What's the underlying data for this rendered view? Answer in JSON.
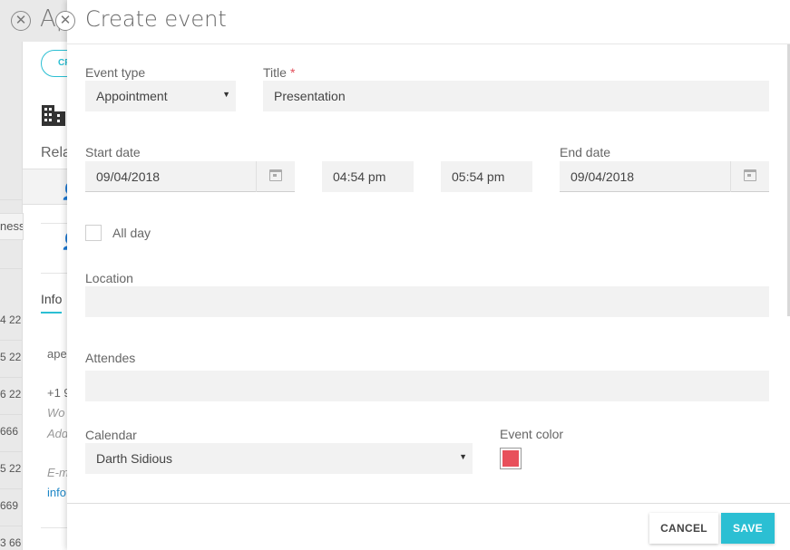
{
  "background": {
    "title": "Ap",
    "pill_label": "CR",
    "related_label": "Rela",
    "info_tab": "Info",
    "info_lines": [
      "ape",
      "+1 9",
      "Wo",
      "Add",
      "E-m",
      "info"
    ],
    "left_edge_box": "ness",
    "left_edge_rows": [
      "4 22",
      "5 22",
      "6 22",
      "666",
      "5 22",
      "669",
      "3 66"
    ]
  },
  "modal": {
    "title": "Create event",
    "event_type": {
      "label": "Event type",
      "value": "Appointment"
    },
    "title_field": {
      "label": "Title",
      "required_mark": "*",
      "value": "Presentation"
    },
    "start_date": {
      "label": "Start date",
      "value": "09/04/2018"
    },
    "start_time": {
      "value": "04:54 pm"
    },
    "end_time": {
      "value": "05:54 pm"
    },
    "end_date": {
      "label": "End date",
      "value": "09/04/2018"
    },
    "all_day": {
      "label": "All day"
    },
    "location": {
      "label": "Location",
      "value": ""
    },
    "attendees": {
      "label": "Attendes",
      "value": ""
    },
    "calendar": {
      "label": "Calendar",
      "value": "Darth Sidious"
    },
    "event_color": {
      "label": "Event color",
      "color": "#e8505b"
    },
    "cancel_label": "CANCEL",
    "save_label": "SAVE",
    "accent_color": "#2bbfd3"
  }
}
